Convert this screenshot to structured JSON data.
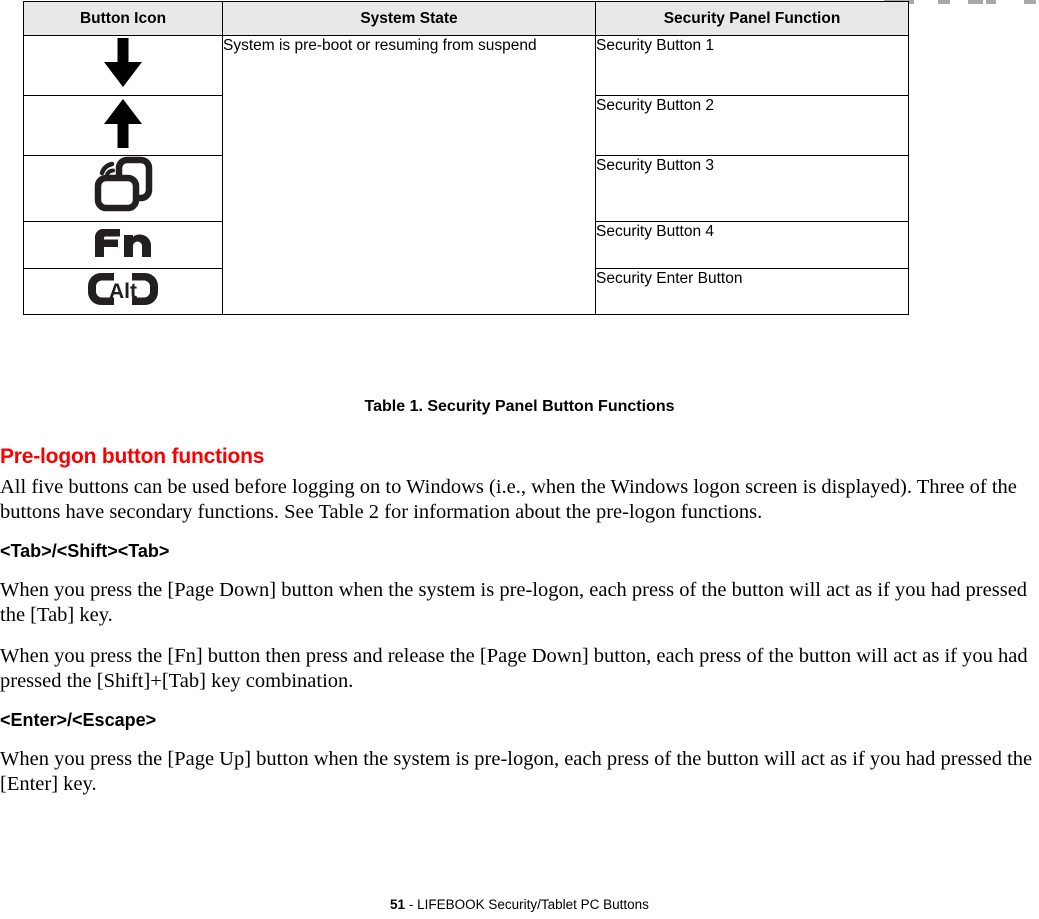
{
  "table": {
    "headers": [
      "Button Icon",
      "System State",
      "Security Panel Function"
    ],
    "rows": [
      {
        "icon": "arrow-down-icon",
        "state": "System is pre-boot or resuming from suspend",
        "function": "Security Button 1"
      },
      {
        "icon": "arrow-up-icon",
        "state": "",
        "function": "Security Button 2"
      },
      {
        "icon": "screen-rotation-icon",
        "state": "",
        "function": "Security Button 3"
      },
      {
        "icon": "fn-key-icon",
        "state": "",
        "function": "Security Button 4"
      },
      {
        "icon": "alt-key-icon",
        "state": "",
        "function": "Security Enter Button"
      }
    ],
    "caption": "Table 1.  Security Panel Button Functions"
  },
  "section": {
    "heading": "Pre-logon button functions",
    "heading_color": "#fc0000",
    "intro": "All five buttons can be used before logging on to Windows (i.e., when the Windows logon screen is displayed). Three of the buttons have secondary functions. See Table 2 for information about the pre-logon functions.",
    "subsections": [
      {
        "heading": "<Tab>/<Shift><Tab>",
        "paragraphs": [
          "When you press the [Page Down] button when the system is pre-logon, each press of the button will act as if you had pressed the [Tab] key.",
          "When you press the [Fn] button then press and release the [Page Down] button, each press of the button will act as if you had pressed the [Shift]+[Tab] key combination."
        ]
      },
      {
        "heading": "<Enter>/<Escape>",
        "paragraphs": [
          "When you press the [Page Up] button when the system is pre-logon, each press of the button will act as if you had pressed the [Enter] key."
        ]
      }
    ]
  },
  "footer": {
    "page_number": "51",
    "separator": " - ",
    "title": "LIFEBOOK Security/Tablet PC Buttons"
  }
}
